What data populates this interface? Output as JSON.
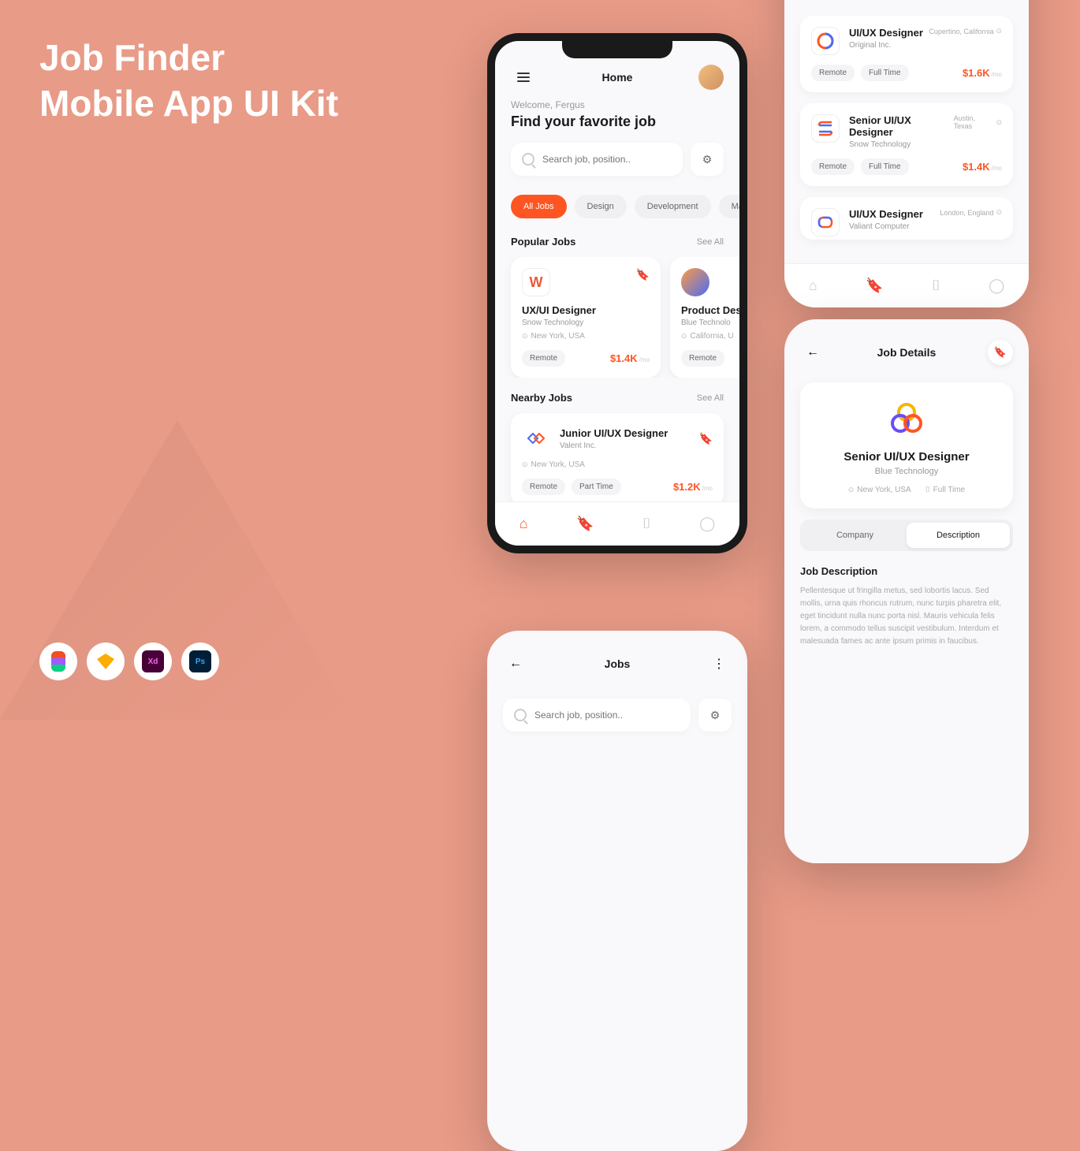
{
  "hero": {
    "line1": "Job Finder",
    "line2": "Mobile App UI Kit"
  },
  "tools": {
    "xd": "Xd",
    "ps": "Ps"
  },
  "home": {
    "title": "Home",
    "welcome": "Welcome, Fergus",
    "headline": "Find your favorite job",
    "search_placeholder": "Search job, position..",
    "cats": [
      "All Jobs",
      "Design",
      "Development",
      "Mark"
    ],
    "popular_title": "Popular Jobs",
    "see_all": "See All",
    "popular": [
      {
        "title": "UX/UI Designer",
        "company": "Snow Technology",
        "location": "New York, USA",
        "tag": "Remote",
        "salary": "$1.4K",
        "per": "/mo",
        "bookmarked": true
      },
      {
        "title": "Product Desi",
        "company": "Blue Technolo",
        "location": "California, U",
        "tag": "Remote",
        "salary": "",
        "per": ""
      }
    ],
    "nearby_title": "Nearby Jobs",
    "nearby": {
      "title": "Junior UI/UX Designer",
      "company": "Valent Inc.",
      "location": "New York, USA",
      "tags": [
        "Remote",
        "Part Time"
      ],
      "salary": "$1.2K",
      "per": "/mo"
    }
  },
  "saved": {
    "items": [
      {
        "title": "UI/UX Designer",
        "company": "Original Inc.",
        "location": "Cupertino, California",
        "tags": [
          "Remote",
          "Full Time"
        ],
        "salary": "$1.6K",
        "per": "/mo"
      },
      {
        "title": "Senior UI/UX Designer",
        "company": "Snow Technology",
        "location": "Austin, Texas",
        "tags": [
          "Remote",
          "Full Time"
        ],
        "salary": "$1.4K",
        "per": "/mo"
      },
      {
        "title": "UI/UX Designer",
        "company": "Valiant Computer",
        "location": "London, England",
        "tags": [],
        "salary": "",
        "per": ""
      }
    ]
  },
  "jobs": {
    "title": "Jobs",
    "search_placeholder": "Search job, position.."
  },
  "details": {
    "title": "Job Details",
    "job_title": "Senior UI/UX Designer",
    "company": "Blue Technology",
    "location": "New York, USA",
    "type": "Full Time",
    "tabs": [
      "Company",
      "Description"
    ],
    "desc_head": "Job Description",
    "desc_text": "Pellentesque ut fringilla metus, sed lobortis lacus. Sed mollis, urna quis rhoncus rutrum, nunc turpis pharetra elit, eget tincidunt nulla nunc porta nisl. Mauris vehicula felis lorem, a commodo tellus suscipit vestibulum. Interdum et malesuada fames ac ante ipsum primis in faucibus."
  }
}
